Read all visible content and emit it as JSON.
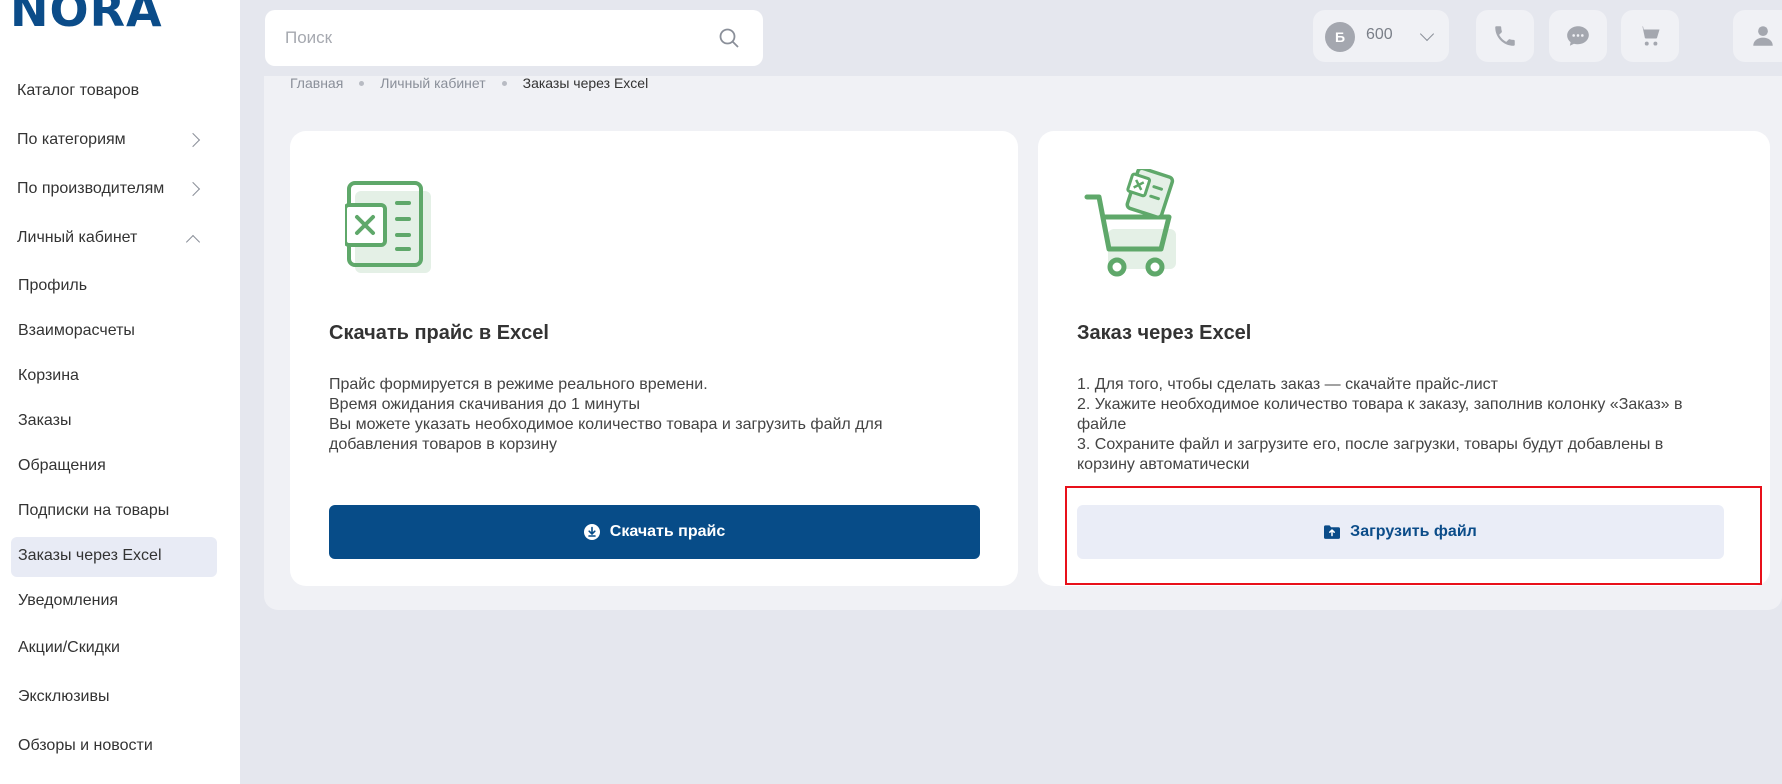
{
  "logo": {
    "text": "NORA"
  },
  "sidebar": {
    "items": [
      {
        "label": "Каталог товаров"
      },
      {
        "label": "По категориям"
      },
      {
        "label": "По производителям"
      },
      {
        "label": "Личный кабинет"
      },
      {
        "label": "Профиль"
      },
      {
        "label": "Взаиморасчеты"
      },
      {
        "label": "Корзина"
      },
      {
        "label": "Заказы"
      },
      {
        "label": "Обращения"
      },
      {
        "label": "Подписки на товары"
      },
      {
        "label": "Заказы через Excel"
      },
      {
        "label": "Уведомления"
      },
      {
        "label": "Акции/Скидки"
      },
      {
        "label": "Эксклюзивы"
      },
      {
        "label": "Обзоры и новости"
      }
    ],
    "active": "Заказы через Excel"
  },
  "header": {
    "search_placeholder": "Поиск",
    "balance_badge": "Б",
    "balance_value": "600"
  },
  "breadcrumb": [
    "Главная",
    "Личный кабинет",
    "Заказы через Excel"
  ],
  "card_price": {
    "title": "Скачать прайс в Excel",
    "lines": [
      "Прайс формируется в режиме реального времени.",
      "Время ожидания скачивания до 1 минуты",
      "Вы можете указать необходимое количество товара и загрузить файл для",
      "добавления товаров в корзину"
    ],
    "button": "Скачать прайс"
  },
  "card_order": {
    "title": "Заказ через Excel",
    "lines": [
      "1. Для того, чтобы сделать заказ — скачайте прайс-лист",
      "2. Укажите необходимое количество товара к заказу, заполнив колонку «Заказ» в",
      "файле",
      "3. Сохраните файл и загрузите его, после загрузки, товары будут добавлены в",
      "корзину автоматически"
    ],
    "button": "Загрузить файл"
  },
  "colors": {
    "primary": "#074c88",
    "accent_green": "#5fa86a",
    "highlight_red": "#e8101a"
  }
}
